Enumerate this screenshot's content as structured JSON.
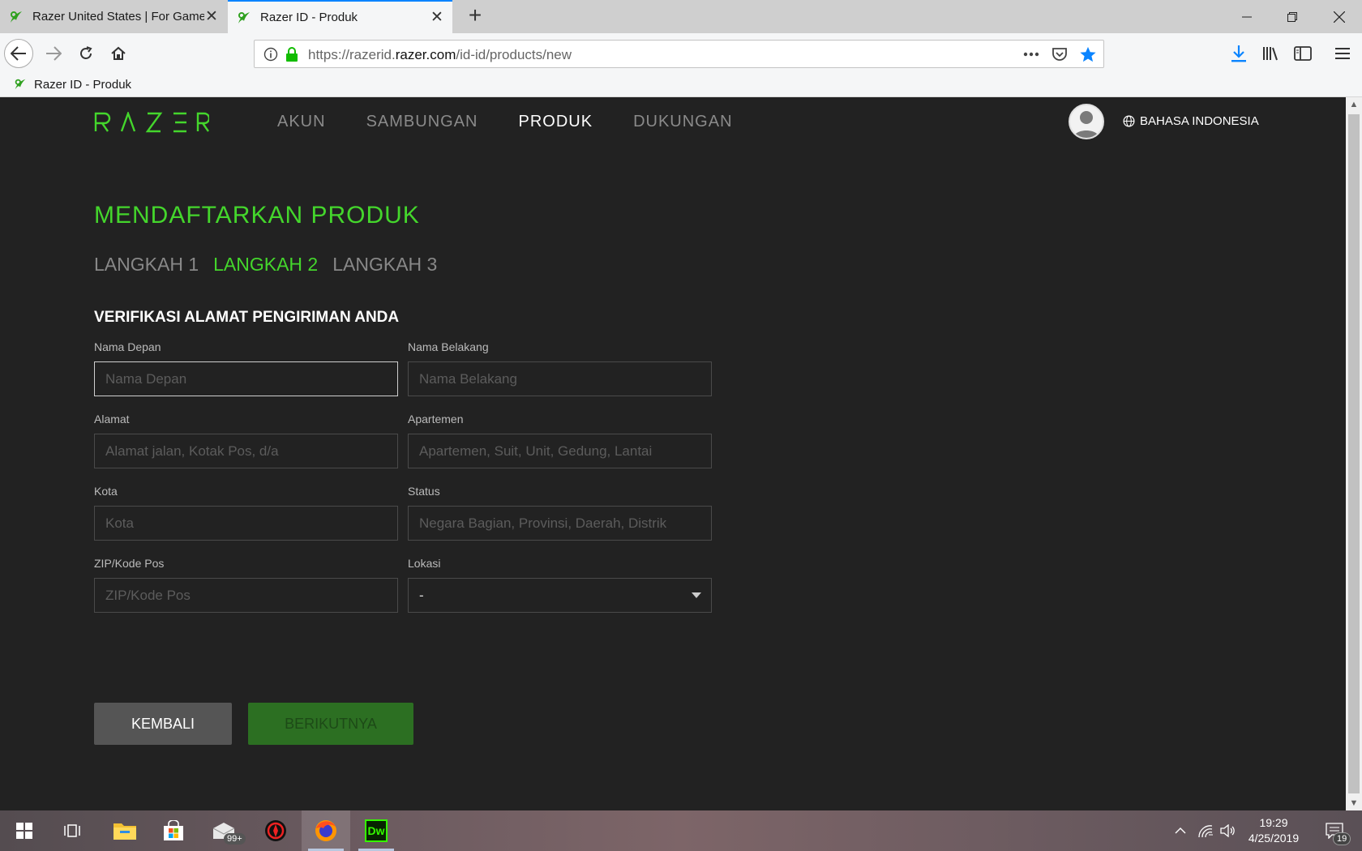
{
  "browser": {
    "tabs": [
      {
        "title": "Razer United States | For Gamers. By Gamers.",
        "active": false
      },
      {
        "title": "Razer ID - Produk",
        "active": true
      }
    ],
    "url": {
      "scheme": "https://razerid.",
      "domain": "razer.com",
      "path": "/id-id/products/new"
    },
    "bookmark": "Razer ID - Produk"
  },
  "header": {
    "logo_text": "RAZER",
    "nav": [
      "AKUN",
      "SAMBUNGAN",
      "PRODUK",
      "DUKUNGAN"
    ],
    "current_nav": "PRODUK",
    "language": "BAHASA INDONESIA"
  },
  "page": {
    "title": "MENDAFTARKAN PRODUK",
    "steps": [
      "LANGKAH 1",
      "LANGKAH 2",
      "LANGKAH 3"
    ],
    "current_step": "LANGKAH 2",
    "section_title": "VERIFIKASI ALAMAT PENGIRIMAN ANDA"
  },
  "form": {
    "first_name": {
      "label": "Nama Depan",
      "placeholder": "Nama Depan",
      "value": ""
    },
    "last_name": {
      "label": "Nama Belakang",
      "placeholder": "Nama Belakang",
      "value": ""
    },
    "address": {
      "label": "Alamat",
      "placeholder": "Alamat jalan, Kotak Pos, d/a",
      "value": ""
    },
    "apartment": {
      "label": "Apartemen",
      "placeholder": "Apartemen, Suit, Unit, Gedung, Lantai",
      "value": ""
    },
    "city": {
      "label": "Kota",
      "placeholder": "Kota",
      "value": ""
    },
    "state": {
      "label": "Status",
      "placeholder": "Negara Bagian, Provinsi, Daerah, Distrik",
      "value": ""
    },
    "zip": {
      "label": "ZIP/Kode Pos",
      "placeholder": "ZIP/Kode Pos",
      "value": ""
    },
    "location": {
      "label": "Lokasi",
      "selected": "-"
    }
  },
  "buttons": {
    "back": "KEMBALI",
    "next": "BERIKUTNYA"
  },
  "taskbar": {
    "mail_badge": "99+",
    "time": "19:29",
    "date": "4/25/2019",
    "notification_count": "19",
    "dw_label": "Dw"
  },
  "colors": {
    "accent_green": "#44d62c",
    "page_bg": "#222222",
    "next_button_bg": "#2c6f22",
    "back_button_bg": "#555555"
  }
}
